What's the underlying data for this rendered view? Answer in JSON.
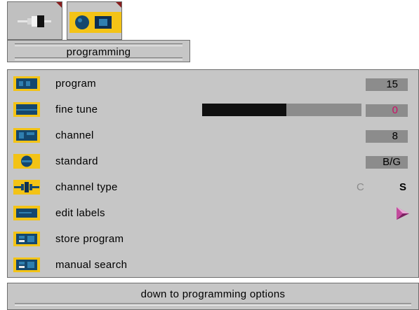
{
  "tabs": [
    {
      "icon": "connector-icon",
      "active": false
    },
    {
      "icon": "tv-settings-icon",
      "active": true
    }
  ],
  "title": "programming",
  "menu": [
    {
      "label": "program",
      "icon": "program-icon",
      "value": "15"
    },
    {
      "label": "fine tune",
      "icon": "fine-tune-icon",
      "value": "0",
      "value_color": "#cc1166",
      "level": 0.53
    },
    {
      "label": "channel",
      "icon": "channel-icon",
      "value": "8"
    },
    {
      "label": "standard",
      "icon": "standard-icon",
      "value": "B/G"
    },
    {
      "label": "channel type",
      "icon": "channel-type-icon",
      "option_c": "C",
      "option_s": "S"
    },
    {
      "label": "edit labels",
      "icon": "edit-labels-icon"
    },
    {
      "label": "store program",
      "icon": "store-program-icon"
    },
    {
      "label": "manual search",
      "icon": "manual-search-icon"
    }
  ],
  "footer": "down to programming options",
  "colors": {
    "accent": "#f3c316",
    "panel": "#c6c6c6",
    "arrow": "#c24a9c"
  }
}
